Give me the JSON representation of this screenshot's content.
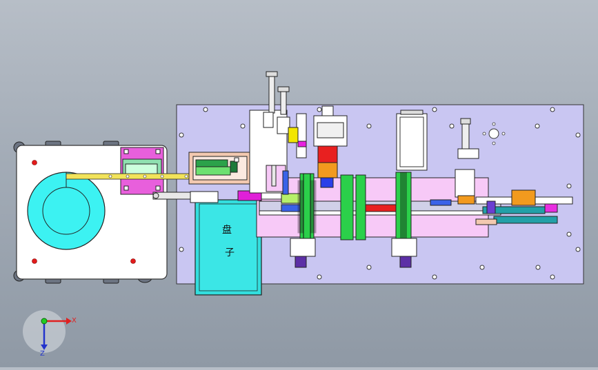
{
  "viewport": {
    "background_top": "#b7bec7",
    "background_bottom": "#8f99a5"
  },
  "model": {
    "base_plate_color": "#c9c6f2",
    "tray_label_line1": "盘",
    "tray_label_line2": "子",
    "tray_color": "#33dede",
    "conveyor_color": "#f7c9f7",
    "reel_color": "#3cf2f2"
  },
  "triad": {
    "x_label": "X",
    "z_label": "Z",
    "x_color": "#e02020",
    "z_color": "#2233cc",
    "origin_color": "#22cc22"
  }
}
